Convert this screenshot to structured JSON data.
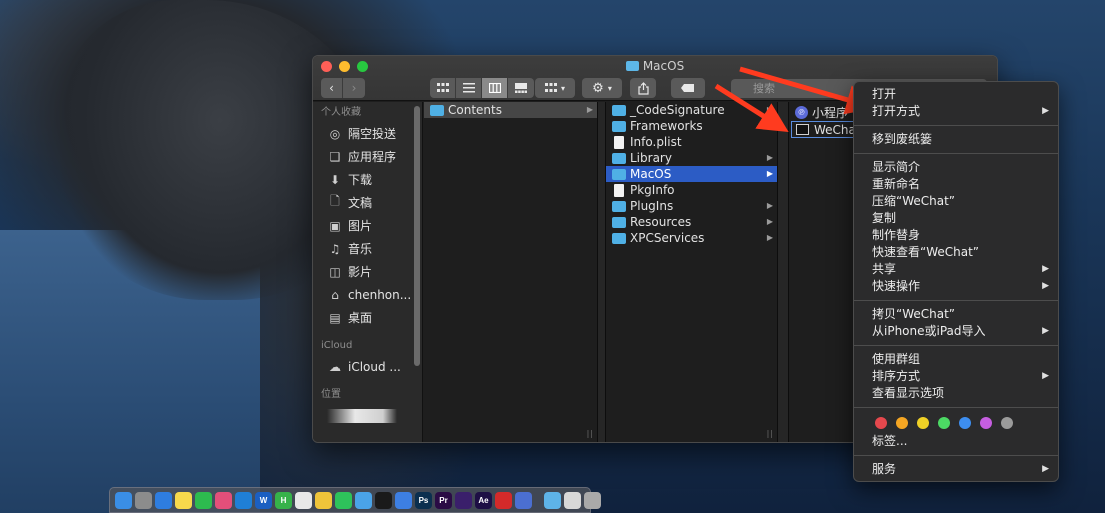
{
  "window": {
    "title": "MacOS",
    "search_placeholder": "搜索"
  },
  "sidebar": {
    "sections": [
      {
        "header": "个人收藏",
        "items": [
          {
            "label": "隔空投送",
            "icon": "airdrop-icon"
          },
          {
            "label": "应用程序",
            "icon": "applications-icon"
          },
          {
            "label": "下载",
            "icon": "download-icon"
          },
          {
            "label": "文稿",
            "icon": "documents-icon"
          },
          {
            "label": "图片",
            "icon": "pictures-icon"
          },
          {
            "label": "音乐",
            "icon": "music-icon"
          },
          {
            "label": "影片",
            "icon": "movies-icon"
          },
          {
            "label": "chenhon...",
            "icon": "home-icon"
          },
          {
            "label": "桌面",
            "icon": "desktop-icon"
          }
        ]
      },
      {
        "header": "iCloud",
        "items": [
          {
            "label": "iCloud ...",
            "icon": "cloud-icon"
          }
        ]
      },
      {
        "header": "位置",
        "items": []
      }
    ]
  },
  "columns": {
    "col1": [
      {
        "label": "Contents",
        "type": "folder",
        "has_children": true,
        "selected": "grey"
      }
    ],
    "col2": [
      {
        "label": "_CodeSignature",
        "type": "folder",
        "has_children": true
      },
      {
        "label": "Frameworks",
        "type": "folder",
        "has_children": true
      },
      {
        "label": "Info.plist",
        "type": "file",
        "has_children": false
      },
      {
        "label": "Library",
        "type": "folder",
        "has_children": true
      },
      {
        "label": "MacOS",
        "type": "folder",
        "has_children": true,
        "selected": "blue"
      },
      {
        "label": "PkgInfo",
        "type": "file",
        "has_children": false
      },
      {
        "label": "PlugIns",
        "type": "folder",
        "has_children": true
      },
      {
        "label": "Resources",
        "type": "folder",
        "has_children": true
      },
      {
        "label": "XPCServices",
        "type": "folder",
        "has_children": true
      }
    ],
    "col3": [
      {
        "label": "小程序",
        "type": "app"
      },
      {
        "label": "WeChat",
        "type": "exec"
      }
    ]
  },
  "context_menu": {
    "groups": [
      [
        {
          "label": "打开",
          "submenu": false
        },
        {
          "label": "打开方式",
          "submenu": true
        }
      ],
      [
        {
          "label": "移到废纸篓",
          "submenu": false
        }
      ],
      [
        {
          "label": "显示简介",
          "submenu": false
        },
        {
          "label": "重新命名",
          "submenu": false
        },
        {
          "label": "压缩“WeChat”",
          "submenu": false
        },
        {
          "label": "复制",
          "submenu": false
        },
        {
          "label": "制作替身",
          "submenu": false
        },
        {
          "label": "快速查看“WeChat”",
          "submenu": false
        },
        {
          "label": "共享",
          "submenu": true
        },
        {
          "label": "快速操作",
          "submenu": true
        }
      ],
      [
        {
          "label": "拷贝“WeChat”",
          "submenu": false
        },
        {
          "label": "从iPhone或iPad导入",
          "submenu": true
        }
      ],
      [
        {
          "label": "使用群组",
          "submenu": false
        },
        {
          "label": "排序方式",
          "submenu": true
        },
        {
          "label": "查看显示选项",
          "submenu": false
        }
      ]
    ],
    "tag_colors": [
      "#e5484d",
      "#f5a623",
      "#f0d126",
      "#4cd964",
      "#3d8ef0",
      "#c65ee0",
      "#9b9b9b"
    ],
    "tags_label": "标签...",
    "services_label": "服务"
  },
  "dock": {
    "apps": [
      {
        "icon": "finder-icon",
        "color": "#3a8ee6",
        "glyph": ""
      },
      {
        "icon": "launchpad-icon",
        "color": "#8c8c8c",
        "glyph": ""
      },
      {
        "icon": "safari-icon",
        "color": "#2e7de0",
        "glyph": ""
      },
      {
        "icon": "notes-icon",
        "color": "#f7d94c",
        "glyph": ""
      },
      {
        "icon": "wechat-devtools-icon",
        "color": "#2dbb4f",
        "glyph": ""
      },
      {
        "icon": "intellij-icon",
        "color": "#e34f7a",
        "glyph": ""
      },
      {
        "icon": "vscode-icon",
        "color": "#1f7fd6",
        "glyph": ""
      },
      {
        "icon": "word-icon",
        "color": "#1b5fc1",
        "glyph": "W"
      },
      {
        "icon": "hbuilder-icon",
        "color": "#36b24a",
        "glyph": "H"
      },
      {
        "icon": "messages-icon",
        "color": "#e8e8e8",
        "glyph": ""
      },
      {
        "icon": "chrome-icon",
        "color": "#f0c43a",
        "glyph": ""
      },
      {
        "icon": "wechat-icon",
        "color": "#2ec25b",
        "glyph": ""
      },
      {
        "icon": "qq-icon",
        "color": "#4aa3e8",
        "glyph": ""
      },
      {
        "icon": "terminal-icon",
        "color": "#1a1a1a",
        "glyph": ""
      },
      {
        "icon": "maps-icon",
        "color": "#3d7fe3",
        "glyph": ""
      },
      {
        "icon": "photoshop-icon",
        "color": "#0b2f4f",
        "glyph": "Ps"
      },
      {
        "icon": "premiere-icon",
        "color": "#2a0b45",
        "glyph": "Pr"
      },
      {
        "icon": "app-icon",
        "color": "#3a1f6b",
        "glyph": ""
      },
      {
        "icon": "aftereffects-icon",
        "color": "#1e0f45",
        "glyph": "Ae"
      },
      {
        "icon": "iqiyi-icon",
        "color": "#d42a2a",
        "glyph": ""
      },
      {
        "icon": "app2-icon",
        "color": "#4b6fd1",
        "glyph": ""
      }
    ],
    "right": [
      {
        "icon": "folder-icon",
        "color": "#5eb3e8"
      },
      {
        "icon": "drive-icon",
        "color": "#d8d8d8"
      },
      {
        "icon": "trash-icon",
        "color": "#a9a9a9"
      }
    ]
  }
}
